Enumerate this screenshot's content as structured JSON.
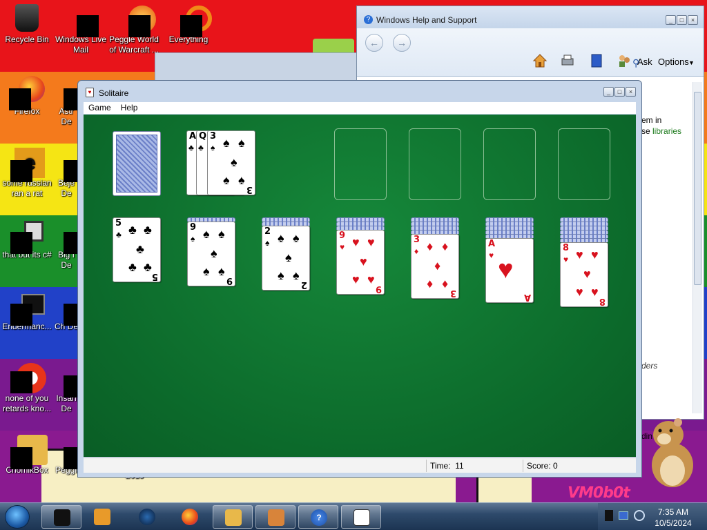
{
  "desktop": {
    "icons": [
      {
        "label": "Recycle Bin"
      },
      {
        "label": "Windows Live Mail"
      },
      {
        "label": "Peggle World of Warcraft ..."
      },
      {
        "label": "Everything"
      },
      {
        "label": "Firefox"
      },
      {
        "label": "Astr De"
      },
      {
        "label": "some russian ran a rat"
      },
      {
        "label": "Beje De"
      },
      {
        "label": "that but its c#"
      },
      {
        "label": "Big I De"
      },
      {
        "label": "Endermanc..."
      },
      {
        "label": "Ch De"
      },
      {
        "label": "none of you retards kno..."
      },
      {
        "label": "Insan De"
      },
      {
        "label": "ChomikBox"
      },
      {
        "label": "Peggle Delux"
      },
      {
        "label": "2015"
      }
    ],
    "wallpaper_text": "VM0b0t"
  },
  "help_window": {
    "title": "Windows Help and Support",
    "back_icon": "back-arrow-icon",
    "forward_icon": "forward-arrow-icon",
    "toolbar_icons": [
      "home-icon",
      "print-icon",
      "browse-help-icon",
      "ask-people-icon"
    ],
    "ask_label": "Ask",
    "options_label": "Options",
    "search_icon": "search-icon",
    "body_line1": "em in",
    "body_line2_prefix": "se ",
    "body_line2_link": "libraries",
    "body_line3": "ders",
    "body_line4": "din"
  },
  "solitaire": {
    "title": "Solitaire",
    "menu": [
      "Game",
      "Help"
    ],
    "status": {
      "time_label": "Time:",
      "time_value": "11",
      "score_label": "Score:",
      "score_value": "0"
    },
    "stock": {
      "face_down": true
    },
    "waste": [
      {
        "rank": "A",
        "suit": "♣",
        "color": "black"
      },
      {
        "rank": "Q",
        "suit": "♣",
        "color": "black"
      },
      {
        "rank": "3",
        "suit": "♠",
        "color": "black"
      }
    ],
    "foundations": 4,
    "tableau": [
      {
        "hidden": 0,
        "rank": "5",
        "suit": "♣",
        "color": "black"
      },
      {
        "hidden": 1,
        "rank": "9",
        "suit": "♠",
        "color": "black"
      },
      {
        "hidden": 2,
        "rank": "2",
        "suit": "♠",
        "color": "black"
      },
      {
        "hidden": 3,
        "rank": "9",
        "suit": "♥",
        "color": "red"
      },
      {
        "hidden": 4,
        "rank": "3",
        "suit": "♦",
        "color": "red"
      },
      {
        "hidden": 5,
        "rank": "A",
        "suit": "♥",
        "color": "red"
      },
      {
        "hidden": 6,
        "rank": "8",
        "suit": "♥",
        "color": "red"
      }
    ]
  },
  "taskbar": {
    "start_icon": "windows-start-icon",
    "buttons": [
      {
        "name": "task-black-box",
        "icon": "black-box-icon"
      },
      {
        "name": "task-media",
        "icon": "media-player-icon"
      },
      {
        "name": "task-globe",
        "icon": "globe-icon"
      },
      {
        "name": "task-firefox",
        "icon": "firefox-icon"
      },
      {
        "name": "task-chomikbox",
        "icon": "chomikbox-icon"
      },
      {
        "name": "task-home",
        "icon": "home-icon"
      },
      {
        "name": "task-help",
        "icon": "help-icon"
      },
      {
        "name": "task-solitaire",
        "icon": "solitaire-icon"
      }
    ],
    "clock_time": "7:35 AM",
    "clock_date": "10/5/2024"
  },
  "colors": {
    "felt": "#0c6a2b",
    "red_suit": "#d8121e",
    "taskbar": "#2e4a6b",
    "help_link": "#1c7a1c"
  }
}
